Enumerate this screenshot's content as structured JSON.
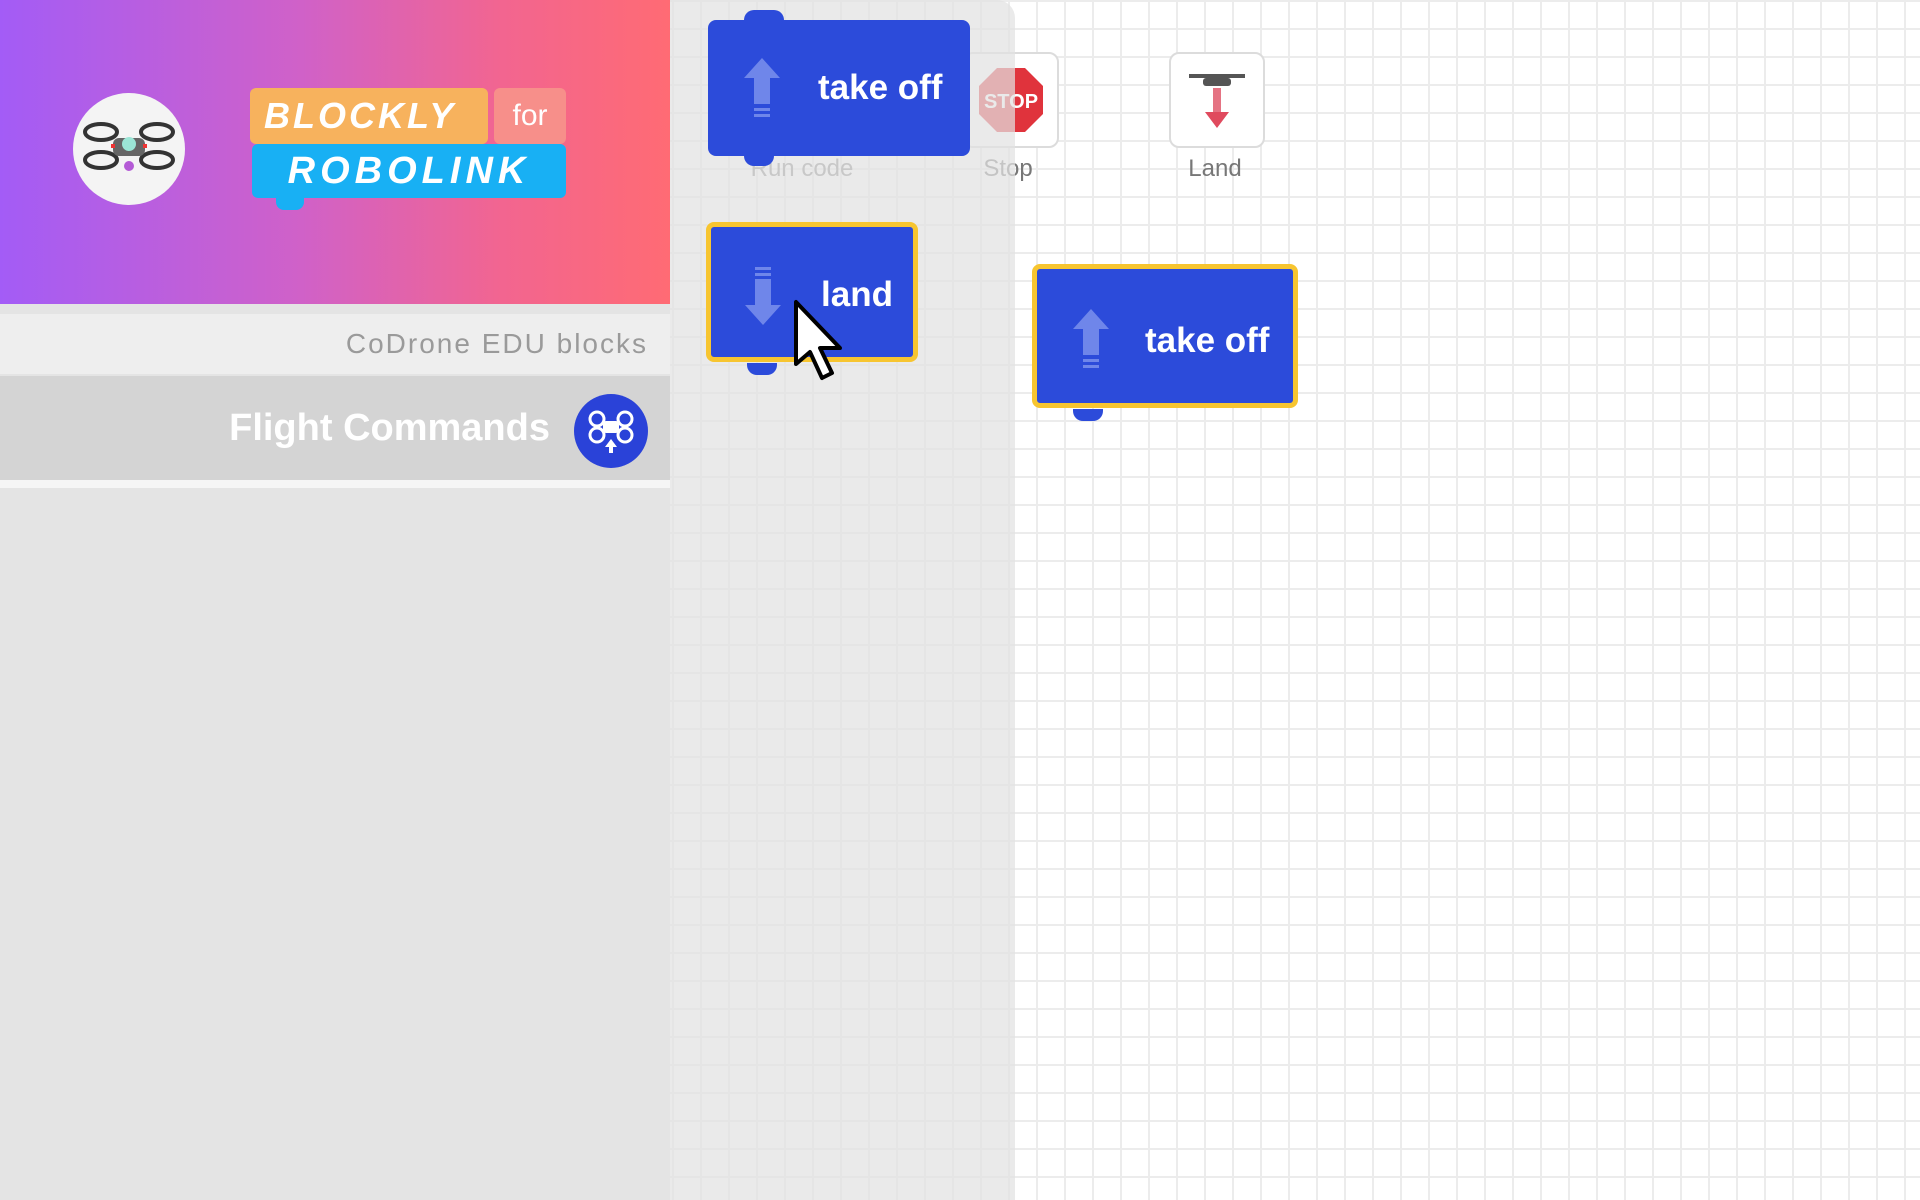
{
  "app": {
    "logo_line1": "BLOCKLY",
    "logo_for": "for",
    "logo_line2": "ROBOLINK"
  },
  "sidebar": {
    "subheader": "CoDrone EDU blocks",
    "category_label": "Flight Commands"
  },
  "toolbar": {
    "run_label": "Run code",
    "stop_label": "Stop",
    "stop_sign_text": "STOP",
    "land_label": "Land"
  },
  "flyout": {
    "takeoff_label": "take off",
    "land_label": "land"
  },
  "workspace": {
    "takeoff_label": "take off"
  },
  "colors": {
    "block_blue": "#2c4bda",
    "selected_outline": "#f7c530",
    "header_gradient_start": "#a35cf6",
    "header_gradient_end": "#ff6b74"
  }
}
